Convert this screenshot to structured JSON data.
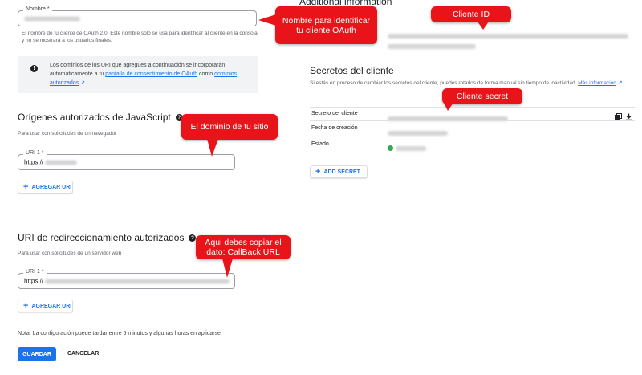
{
  "name_field": {
    "label": "Nombre *",
    "hint": "El nombre de tu cliente de OAuth 2.0. Este nombre solo se usa para identificar al cliente en la consola y no se mostrará a los usuarios finales."
  },
  "info_box": {
    "text_before": "Los dominios de los URI que agregues a continuación se incorporarán automáticamente a tu",
    "link1": "pantalla de consentimiento de OAuth",
    "text_middle": "como",
    "link2": "dominios autorizados"
  },
  "js_origins": {
    "title": "Orígenes autorizados de JavaScript",
    "hint": "Para usar con solicitudes de un navegador",
    "field_label": "URI 1 *",
    "field_value": "https://",
    "add_button": "AGREGAR URI"
  },
  "redirect_uris": {
    "title": "URI de redireccionamiento autorizados",
    "hint": "Para usar con solicitudes de un servidor web",
    "field_label": "URI 1 *",
    "field_value": "https://",
    "add_button": "AGREGAR URI"
  },
  "note": "Nota: La configuración puede tardar entre 5 minutos y algunas horas en aplicarse",
  "actions": {
    "save": "GUARDAR",
    "cancel": "CANCELAR"
  },
  "right": {
    "additional_title": "Additional information",
    "secrets_title": "Secretos del cliente",
    "secrets_hint": "Si estás en proceso de cambiar los secretos del cliente, puedes rotarlos de forma manual sin tiempo de inactividad.",
    "secrets_link": "Más información",
    "rows": {
      "secret": "Secreto del cliente",
      "created": "Fecha de creación",
      "status": "Estado"
    },
    "add_secret": "ADD SECRET"
  },
  "callouts": {
    "name": "Nombre para identificar tu cliente OAuth",
    "client_id": "Cliente ID",
    "client_secret": "Cliente secret",
    "domain": "El dominio de tu sitio",
    "callback": "Aqui debes copiar el dato: CallBack URL"
  },
  "colors": {
    "accent": "#1a73e8",
    "callout": "#e8141a",
    "status_ok": "#34a853"
  },
  "icons": {
    "info": "info-icon",
    "help": "help-icon",
    "copy": "copy-icon",
    "download": "download-icon",
    "plus": "plus-icon",
    "external": "external-link-icon"
  }
}
